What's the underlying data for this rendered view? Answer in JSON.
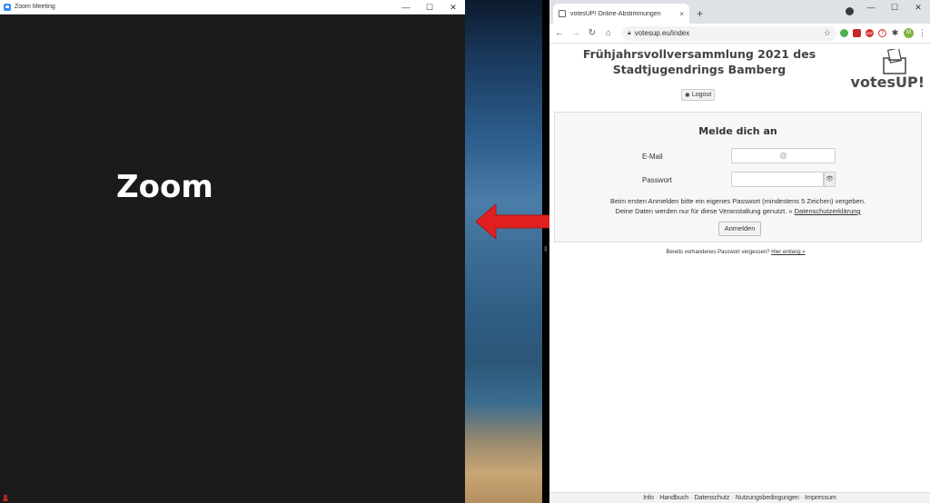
{
  "zoom": {
    "window_title": "Zoom Meeting",
    "label": "Zoom",
    "controls": {
      "minimize": "—",
      "maximize": "☐",
      "close": "✕"
    }
  },
  "chrome": {
    "tab_title": "votesUP! Online-Abstimmungen",
    "tab_close": "×",
    "new_tab": "+",
    "url": "votesup.eu/index",
    "controls": {
      "minimize": "—",
      "maximize": "☐",
      "close": "✕"
    },
    "extension_icons": [
      "green-circle-icon",
      "pdf-icon",
      "abp-icon",
      "lastpass-icon",
      "puzzle-icon"
    ],
    "avatar_letter": "M"
  },
  "page": {
    "title": "Frühjahrsvollversammlung 2021 des Stadtjugendrings Bamberg",
    "logo_text": "votesUP!",
    "logout_label": "Logout",
    "login": {
      "heading": "Melde dich an",
      "email_label": "E-Mail",
      "email_placeholder": "@",
      "password_label": "Passwort",
      "info_line1": "Beim ersten Anmelden bitte ein eigenes Passwort (mindestens 5 Zeichen) vergeben.",
      "info_line2": "Deine Daten werden nur für diese Veranstaltung genutzt. »",
      "privacy_link": "Datenschutzerklärung",
      "submit_label": "Anmelden"
    },
    "forgot_text": "Bereits vorhandenes Passwort vergessen?",
    "forgot_link": "Hier entlang »",
    "footer": [
      "Info",
      "Handbuch",
      "Datenschutz",
      "Nutzungsbedingungen",
      "Impressum"
    ]
  },
  "colors": {
    "arrow": "#e02020",
    "zoom_bg": "#1b1b1b",
    "chrome_tabstrip": "#dee1e6"
  }
}
